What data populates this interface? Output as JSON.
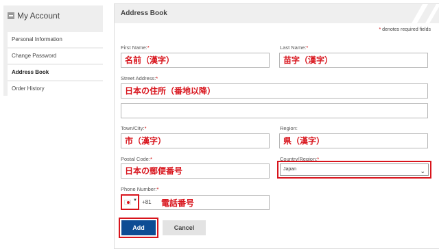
{
  "sidebar": {
    "title": "My Account",
    "items": [
      {
        "label": "Personal Information"
      },
      {
        "label": "Change Password"
      },
      {
        "label": "Address Book"
      },
      {
        "label": "Order History"
      }
    ]
  },
  "panel": {
    "title": "Address Book",
    "required_note": "denotes required fields",
    "required_star": "*"
  },
  "form": {
    "first_name": {
      "label": "First Name:",
      "value": "名前（漢字）"
    },
    "last_name": {
      "label": "Last Name:",
      "value": "苗字（漢字）"
    },
    "street": {
      "label": "Street Address:",
      "value": "日本の住所（番地以降）",
      "value2": ""
    },
    "town": {
      "label": "Town/City:",
      "value": "市（漢字）"
    },
    "region": {
      "label": "Region:",
      "value": "県（漢字）"
    },
    "postal": {
      "label": "Postal Code:",
      "value": "日本の郵便番号"
    },
    "country": {
      "label": "Country/Region:",
      "value": "Japan"
    },
    "phone": {
      "label": "Phone Number:",
      "dial_code": "+81",
      "value": "電話番号"
    }
  },
  "buttons": {
    "add": "Add",
    "cancel": "Cancel"
  },
  "colors": {
    "accent_red": "#d8141c",
    "add_blue": "#0d4c94"
  }
}
